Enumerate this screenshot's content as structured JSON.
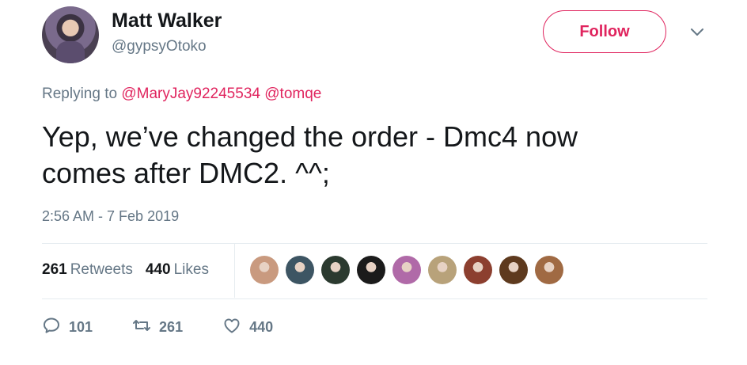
{
  "user": {
    "name": "Matt Walker",
    "handle": "@gypsyOtoko"
  },
  "header": {
    "follow_label": "Follow",
    "menu_icon": "chevron-down-icon"
  },
  "reply": {
    "prefix": "Replying to",
    "mentions": [
      "@MaryJay92245534",
      "@tomqe"
    ]
  },
  "tweet": {
    "line1": "Yep, we’ve changed the order - Dmc4 now",
    "line2": "comes after DMC2. ^^;"
  },
  "timestamp": "2:56 AM - 7 Feb 2019",
  "stats": {
    "retweets_count": "261",
    "retweets_label": "Retweets",
    "likes_count": "440",
    "likes_label": "Likes"
  },
  "likers": [
    {
      "color": "#c99a7f"
    },
    {
      "color": "#3d5563"
    },
    {
      "color": "#2b3a2f"
    },
    {
      "color": "#1b1b1b"
    },
    {
      "color": "#b06aa8"
    },
    {
      "color": "#b8a27a"
    },
    {
      "color": "#8c3f2f"
    },
    {
      "color": "#5e3a1e"
    },
    {
      "color": "#a06a43"
    }
  ],
  "actions": {
    "reply_count": "101",
    "retweet_count": "261",
    "like_count": "440"
  },
  "colors": {
    "accent": "#e0245e",
    "muted": "#657786",
    "text": "#14171a",
    "divider": "#e6ecf0"
  }
}
